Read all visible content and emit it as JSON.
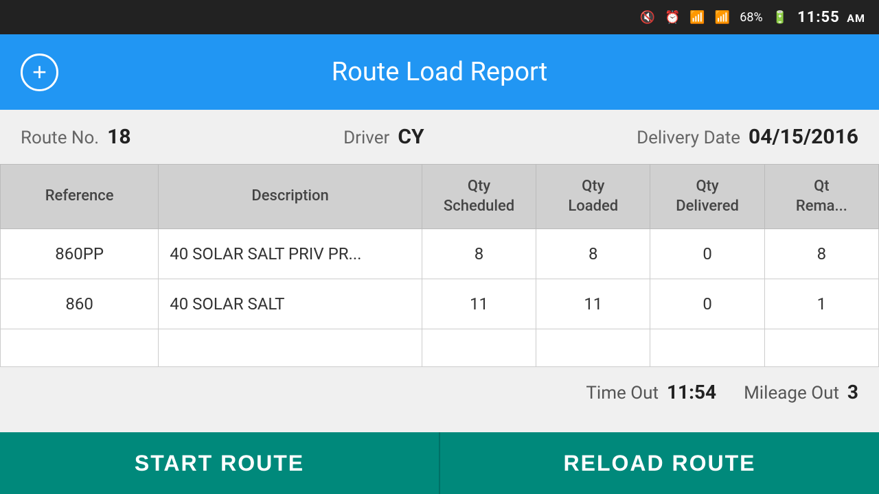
{
  "status_bar": {
    "battery": "68%",
    "time": "11:55",
    "am_pm": "AM"
  },
  "header": {
    "title": "Route Load Report",
    "add_button_label": "+"
  },
  "info": {
    "route_label": "Route No.",
    "route_value": "18",
    "driver_label": "Driver",
    "driver_value": "CY",
    "delivery_label": "Delivery Date",
    "delivery_value": "04/15/2016"
  },
  "table": {
    "headers": {
      "reference": "Reference",
      "description": "Description",
      "qty_scheduled": "Qty\nScheduled",
      "qty_loaded": "Qty\nLoaded",
      "qty_delivered": "Qty\nDelivered",
      "qty_remaining": "Qty\nRema..."
    },
    "rows": [
      {
        "reference": "860PP",
        "description": "40 SOLAR SALT PRIV PR...",
        "qty_scheduled": "8",
        "qty_loaded": "8",
        "qty_delivered": "0",
        "qty_remaining": "8"
      },
      {
        "reference": "860",
        "description": "40 SOLAR SALT",
        "qty_scheduled": "11",
        "qty_loaded": "11",
        "qty_delivered": "0",
        "qty_remaining": "1"
      }
    ]
  },
  "footer": {
    "time_out_label": "Time Out",
    "time_out_value": "11:54",
    "mileage_out_label": "Mileage Out",
    "mileage_out_value": "3"
  },
  "buttons": {
    "start_route": "START ROUTE",
    "reload_route": "RELOAD ROUTE"
  }
}
